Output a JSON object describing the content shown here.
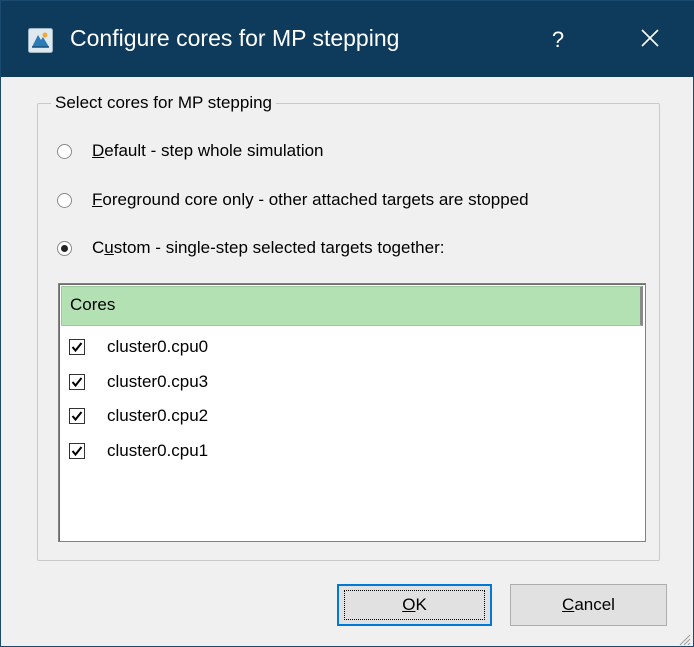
{
  "window": {
    "title": "Configure cores for MP stepping",
    "help_label": "?",
    "icons": {
      "app": "app-icon",
      "close": "close-icon"
    },
    "colors": {
      "titlebar": "#0e3a5b",
      "list_header": "#b4e1b4",
      "focus": "#0078d7"
    }
  },
  "group": {
    "title": "Select cores for MP stepping",
    "options": [
      {
        "accel": "D",
        "rest": "efault - step whole simulation",
        "selected": false
      },
      {
        "accel": "F",
        "rest": "oreground core only - other attached targets are stopped",
        "selected": false
      },
      {
        "pre": "C",
        "accel": "u",
        "rest": "stom - single-step selected targets together:",
        "selected": true
      }
    ]
  },
  "cores": {
    "header": "Cores",
    "items": [
      {
        "label": "cluster0.cpu0",
        "checked": true
      },
      {
        "label": "cluster0.cpu3",
        "checked": true
      },
      {
        "label": "cluster0.cpu2",
        "checked": true
      },
      {
        "label": "cluster0.cpu1",
        "checked": true
      }
    ]
  },
  "buttons": {
    "ok": {
      "accel": "O",
      "rest": "K"
    },
    "cancel": {
      "accel": "C",
      "rest": "ancel"
    }
  }
}
